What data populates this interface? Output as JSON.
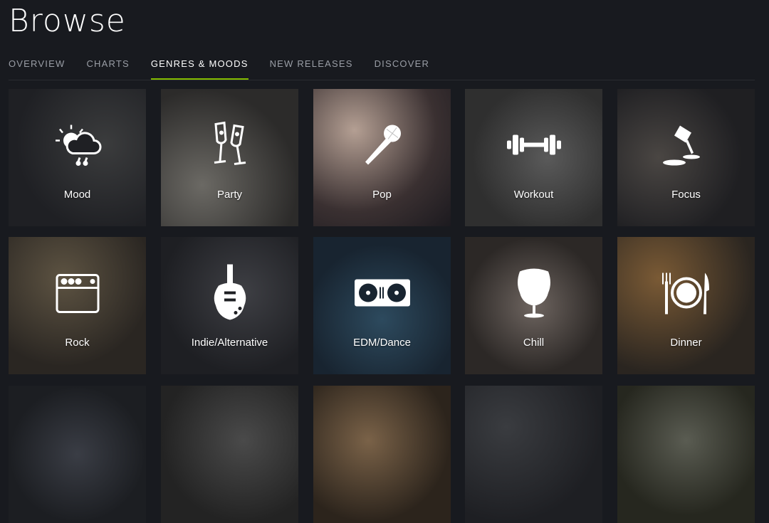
{
  "header": {
    "title": "Browse"
  },
  "tabs": [
    {
      "label": "OVERVIEW"
    },
    {
      "label": "CHARTS"
    },
    {
      "label": "GENRES & MOODS"
    },
    {
      "label": "NEW RELEASES"
    },
    {
      "label": "DISCOVER"
    }
  ],
  "active_tab": "GENRES & MOODS",
  "colors": {
    "accent": "#84bd00",
    "background": "#181a1f"
  },
  "tiles": [
    {
      "label": "Mood",
      "icon": "sun-cloud-rain-icon"
    },
    {
      "label": "Party",
      "icon": "champagne-glasses-icon"
    },
    {
      "label": "Pop",
      "icon": "microphone-icon"
    },
    {
      "label": "Workout",
      "icon": "dumbbell-icon"
    },
    {
      "label": "Focus",
      "icon": "desk-lamp-icon"
    },
    {
      "label": "Rock",
      "icon": "amplifier-icon"
    },
    {
      "label": "Indie/Alternative",
      "icon": "electric-guitar-icon"
    },
    {
      "label": "EDM/Dance",
      "icon": "turntables-icon"
    },
    {
      "label": "Chill",
      "icon": "egg-chair-icon"
    },
    {
      "label": "Dinner",
      "icon": "plate-cutlery-icon"
    }
  ]
}
